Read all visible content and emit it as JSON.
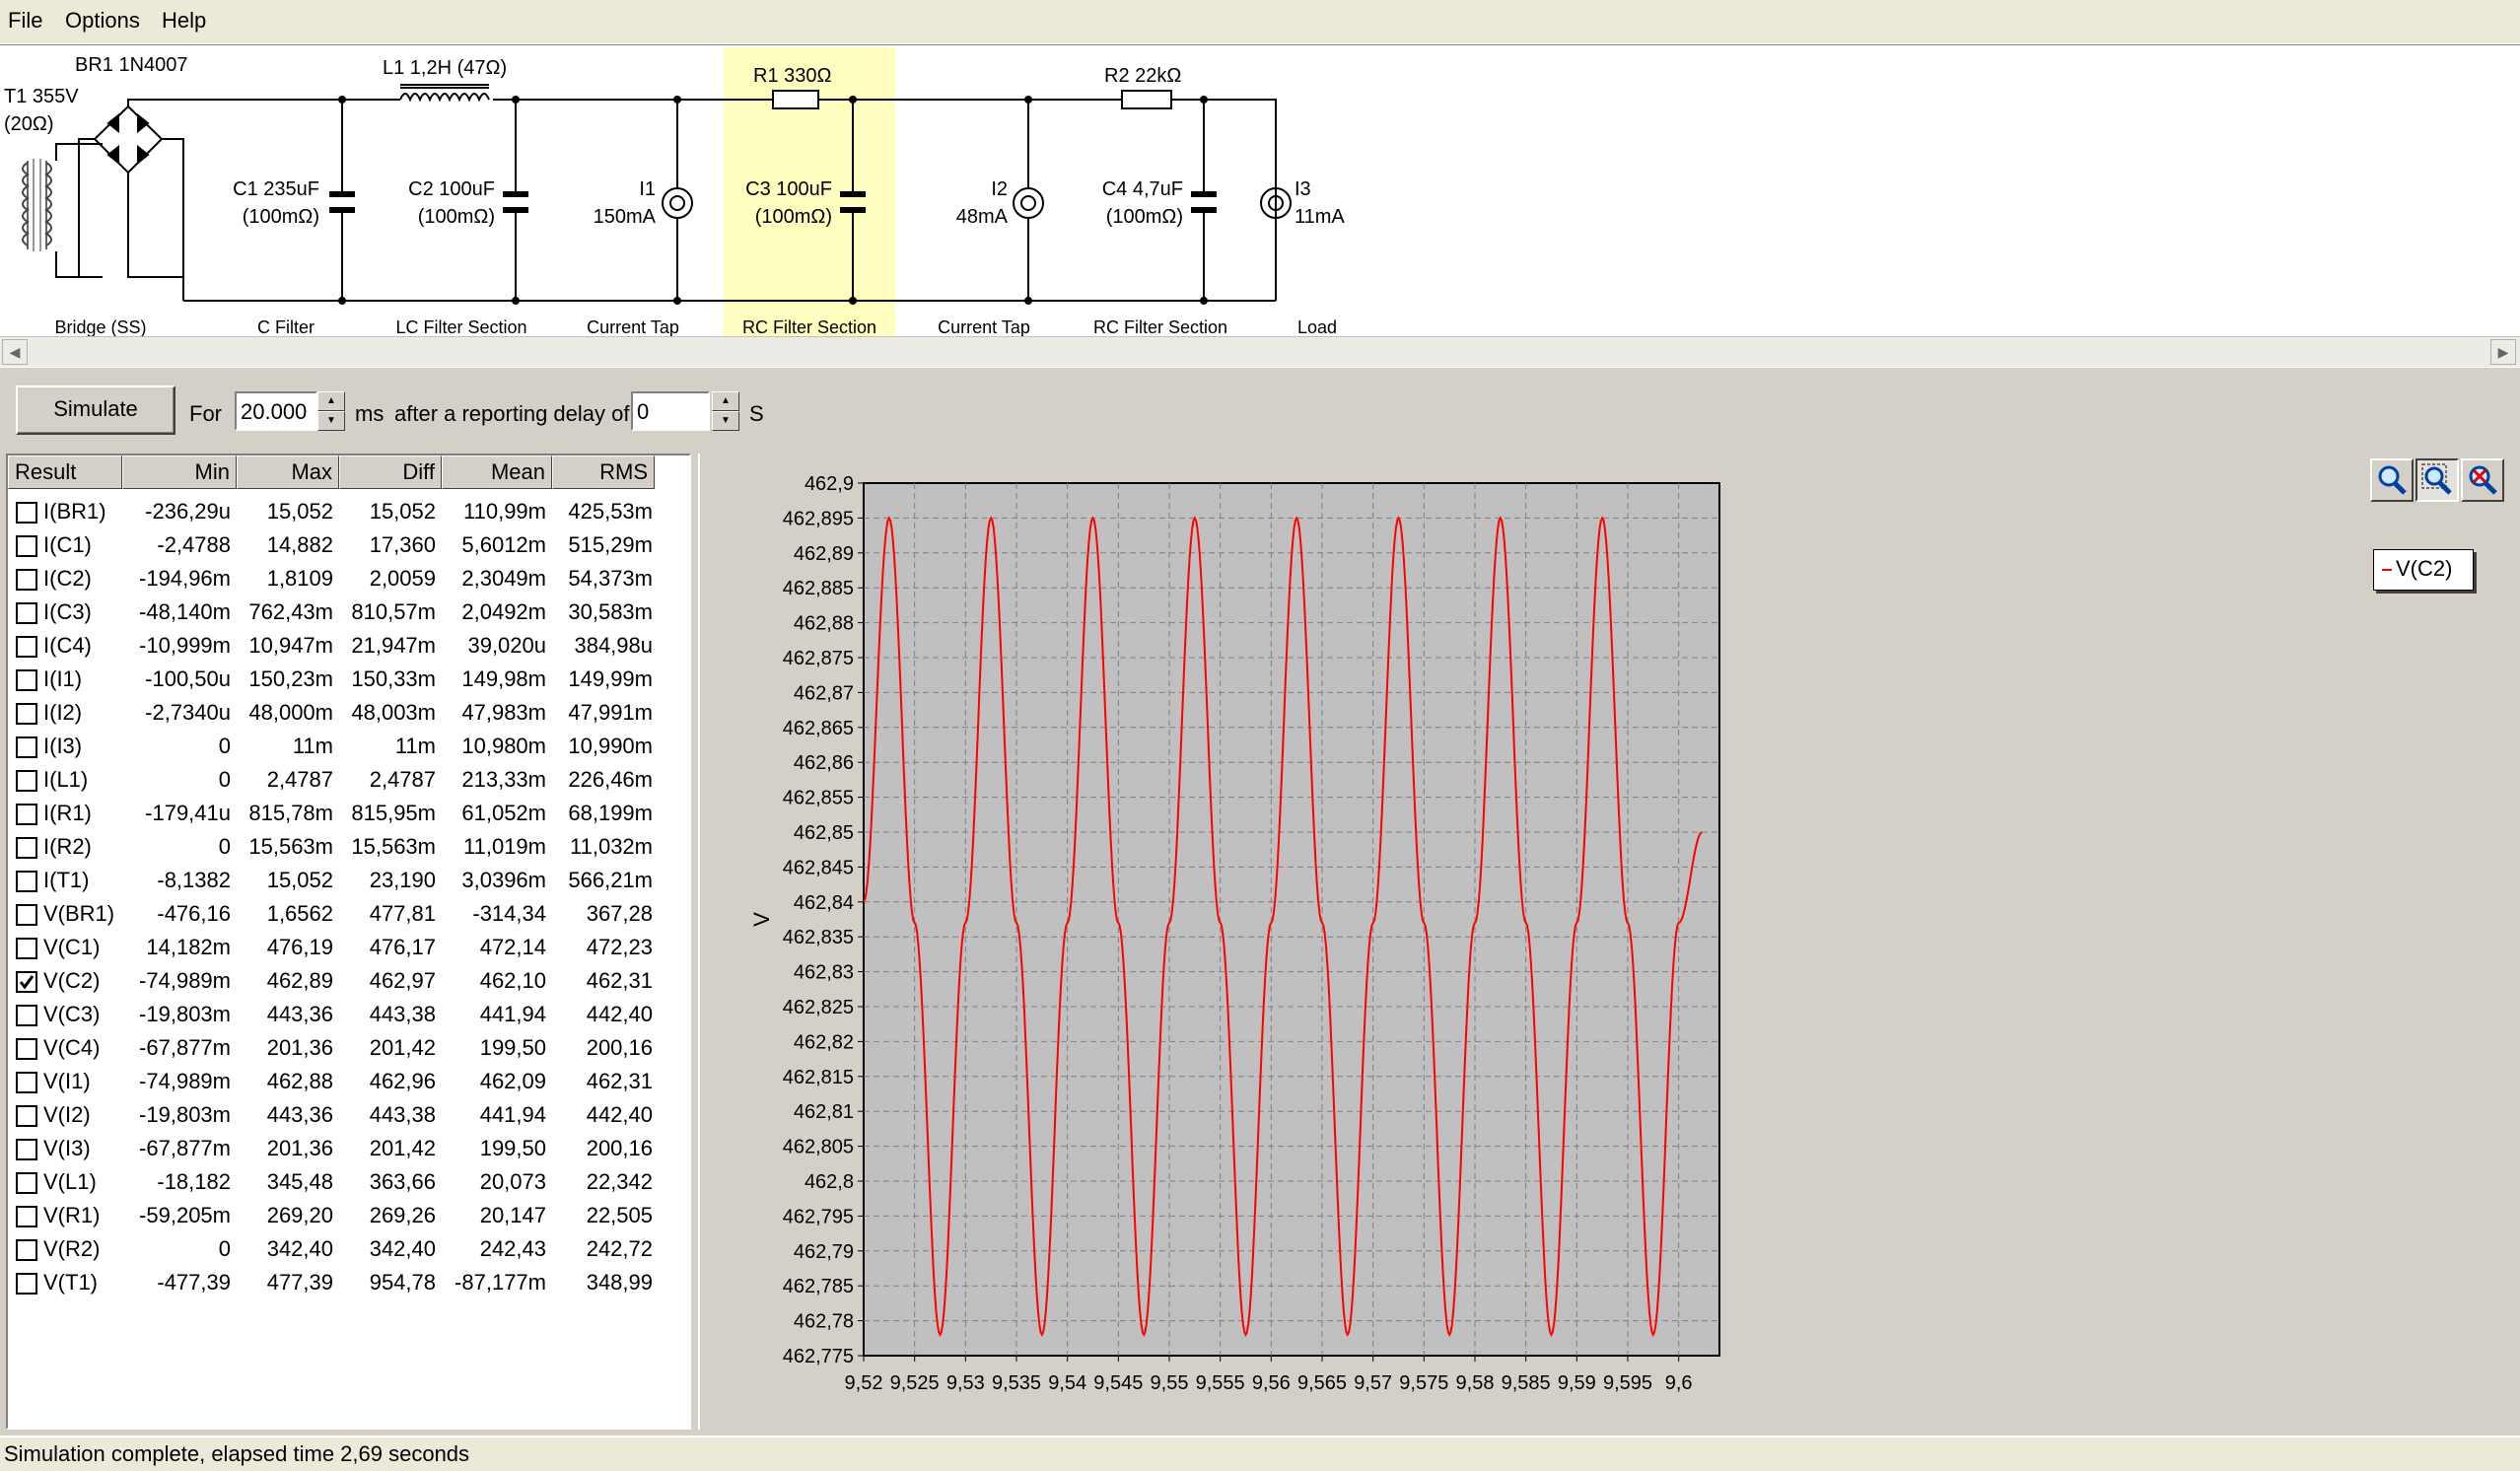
{
  "menu": {
    "file": "File",
    "options": "Options",
    "help": "Help"
  },
  "schematic": {
    "t1_name": "T1 355V",
    "t1_res": "(20Ω)",
    "br1": "BR1 1N4007",
    "l1": "L1 1,2H (47Ω)",
    "r1": "R1 330Ω",
    "r2": "R2 22kΩ",
    "c1_name": "C1 235uF",
    "c1_esr": "(100mΩ)",
    "c2_name": "C2 100uF",
    "c2_esr": "(100mΩ)",
    "i1_name": "I1",
    "i1_val": "150mA",
    "c3_name": "C3 100uF",
    "c3_esr": "(100mΩ)",
    "i2_name": "I2",
    "i2_val": "48mA",
    "c4_name": "C4 4,7uF",
    "c4_esr": "(100mΩ)",
    "i3_name": "I3",
    "i3_val": "11mA",
    "sections": [
      "Bridge (SS)",
      "C Filter",
      "LC Filter Section",
      "Current Tap",
      "RC Filter Section",
      "Current Tap",
      "RC Filter Section",
      "Load"
    ]
  },
  "toolbar": {
    "simulate": "Simulate",
    "for": "For",
    "duration": "20.000",
    "unit_ms": "ms",
    "after_delay": "after a reporting delay of",
    "delay": "0",
    "unit_s": "S"
  },
  "results": {
    "columns": [
      "Result",
      "Min",
      "Max",
      "Diff",
      "Mean",
      "RMS"
    ],
    "rows": [
      {
        "name": "I(BR1)",
        "min": "-236,29u",
        "max": "15,052",
        "diff": "15,052",
        "mean": "110,99m",
        "rms": "425,53m",
        "checked": false
      },
      {
        "name": "I(C1)",
        "min": "-2,4788",
        "max": "14,882",
        "diff": "17,360",
        "mean": "5,6012m",
        "rms": "515,29m",
        "checked": false
      },
      {
        "name": "I(C2)",
        "min": "-194,96m",
        "max": "1,8109",
        "diff": "2,0059",
        "mean": "2,3049m",
        "rms": "54,373m",
        "checked": false
      },
      {
        "name": "I(C3)",
        "min": "-48,140m",
        "max": "762,43m",
        "diff": "810,57m",
        "mean": "2,0492m",
        "rms": "30,583m",
        "checked": false
      },
      {
        "name": "I(C4)",
        "min": "-10,999m",
        "max": "10,947m",
        "diff": "21,947m",
        "mean": "39,020u",
        "rms": "384,98u",
        "checked": false
      },
      {
        "name": "I(I1)",
        "min": "-100,50u",
        "max": "150,23m",
        "diff": "150,33m",
        "mean": "149,98m",
        "rms": "149,99m",
        "checked": false
      },
      {
        "name": "I(I2)",
        "min": "-2,7340u",
        "max": "48,000m",
        "diff": "48,003m",
        "mean": "47,983m",
        "rms": "47,991m",
        "checked": false
      },
      {
        "name": "I(I3)",
        "min": "0",
        "max": "11m",
        "diff": "11m",
        "mean": "10,980m",
        "rms": "10,990m",
        "checked": false
      },
      {
        "name": "I(L1)",
        "min": "0",
        "max": "2,4787",
        "diff": "2,4787",
        "mean": "213,33m",
        "rms": "226,46m",
        "checked": false
      },
      {
        "name": "I(R1)",
        "min": "-179,41u",
        "max": "815,78m",
        "diff": "815,95m",
        "mean": "61,052m",
        "rms": "68,199m",
        "checked": false
      },
      {
        "name": "I(R2)",
        "min": "0",
        "max": "15,563m",
        "diff": "15,563m",
        "mean": "11,019m",
        "rms": "11,032m",
        "checked": false
      },
      {
        "name": "I(T1)",
        "min": "-8,1382",
        "max": "15,052",
        "diff": "23,190",
        "mean": "3,0396m",
        "rms": "566,21m",
        "checked": false
      },
      {
        "name": "V(BR1)",
        "min": "-476,16",
        "max": "1,6562",
        "diff": "477,81",
        "mean": "-314,34",
        "rms": "367,28",
        "checked": false
      },
      {
        "name": "V(C1)",
        "min": "14,182m",
        "max": "476,19",
        "diff": "476,17",
        "mean": "472,14",
        "rms": "472,23",
        "checked": false
      },
      {
        "name": "V(C2)",
        "min": "-74,989m",
        "max": "462,89",
        "diff": "462,97",
        "mean": "462,10",
        "rms": "462,31",
        "checked": true
      },
      {
        "name": "V(C3)",
        "min": "-19,803m",
        "max": "443,36",
        "diff": "443,38",
        "mean": "441,94",
        "rms": "442,40",
        "checked": false
      },
      {
        "name": "V(C4)",
        "min": "-67,877m",
        "max": "201,36",
        "diff": "201,42",
        "mean": "199,50",
        "rms": "200,16",
        "checked": false
      },
      {
        "name": "V(I1)",
        "min": "-74,989m",
        "max": "462,88",
        "diff": "462,96",
        "mean": "462,09",
        "rms": "462,31",
        "checked": false
      },
      {
        "name": "V(I2)",
        "min": "-19,803m",
        "max": "443,36",
        "diff": "443,38",
        "mean": "441,94",
        "rms": "442,40",
        "checked": false
      },
      {
        "name": "V(I3)",
        "min": "-67,877m",
        "max": "201,36",
        "diff": "201,42",
        "mean": "199,50",
        "rms": "200,16",
        "checked": false
      },
      {
        "name": "V(L1)",
        "min": "-18,182",
        "max": "345,48",
        "diff": "363,66",
        "mean": "20,073",
        "rms": "22,342",
        "checked": false
      },
      {
        "name": "V(R1)",
        "min": "-59,205m",
        "max": "269,20",
        "diff": "269,26",
        "mean": "20,147",
        "rms": "22,505",
        "checked": false
      },
      {
        "name": "V(R2)",
        "min": "0",
        "max": "342,40",
        "diff": "342,40",
        "mean": "242,43",
        "rms": "242,72",
        "checked": false
      },
      {
        "name": "V(T1)",
        "min": "-477,39",
        "max": "477,39",
        "diff": "954,78",
        "mean": "-87,177m",
        "rms": "348,99",
        "checked": false
      }
    ]
  },
  "plot": {
    "icons": [
      "zoom-in-icon",
      "zoom-box-icon",
      "zoom-reset-icon"
    ],
    "legend": "V(C2)"
  },
  "chart_data": {
    "type": "line",
    "title": "",
    "xlabel": "",
    "ylabel": "V",
    "xlim": [
      9.52,
      9.604
    ],
    "ylim": [
      462.775,
      462.9
    ],
    "xticks": [
      "9,52",
      "9,525",
      "9,53",
      "9,535",
      "9,54",
      "9,545",
      "9,55",
      "9,555",
      "9,56",
      "9,565",
      "9,57",
      "9,575",
      "9,58",
      "9,585",
      "9,59",
      "9,595",
      "9,6"
    ],
    "yticks": [
      "462,9",
      "462,895",
      "462,89",
      "462,885",
      "462,88",
      "462,875",
      "462,87",
      "462,865",
      "462,86",
      "462,855",
      "462,85",
      "462,845",
      "462,84",
      "462,835",
      "462,83",
      "462,825",
      "462,82",
      "462,815",
      "462,81",
      "462,805",
      "462,8",
      "462,795",
      "462,79",
      "462,785",
      "462,78",
      "462,775"
    ],
    "grid": true,
    "legend_position": "top-right",
    "series": [
      {
        "name": "V(C2)",
        "color": "#ff0000",
        "x": [
          9.52,
          9.5225,
          9.525,
          9.5275,
          9.53,
          9.5325,
          9.535,
          9.5375,
          9.54,
          9.5425,
          9.545,
          9.5475,
          9.55,
          9.5525,
          9.555,
          9.5575,
          9.56,
          9.5625,
          9.565,
          9.5675,
          9.57,
          9.5725,
          9.575,
          9.5775,
          9.58,
          9.5825,
          9.585,
          9.5875,
          9.59,
          9.5925,
          9.595,
          9.5975,
          9.6,
          9.6023
        ],
        "y": [
          462.84,
          462.895,
          462.837,
          462.778,
          462.837,
          462.895,
          462.837,
          462.778,
          462.837,
          462.895,
          462.837,
          462.778,
          462.837,
          462.895,
          462.837,
          462.778,
          462.837,
          462.895,
          462.837,
          462.778,
          462.837,
          462.895,
          462.837,
          462.778,
          462.837,
          462.895,
          462.837,
          462.778,
          462.837,
          462.895,
          462.837,
          462.778,
          462.837,
          462.85
        ]
      }
    ]
  },
  "status": "Simulation complete, elapsed time 2,69 seconds"
}
